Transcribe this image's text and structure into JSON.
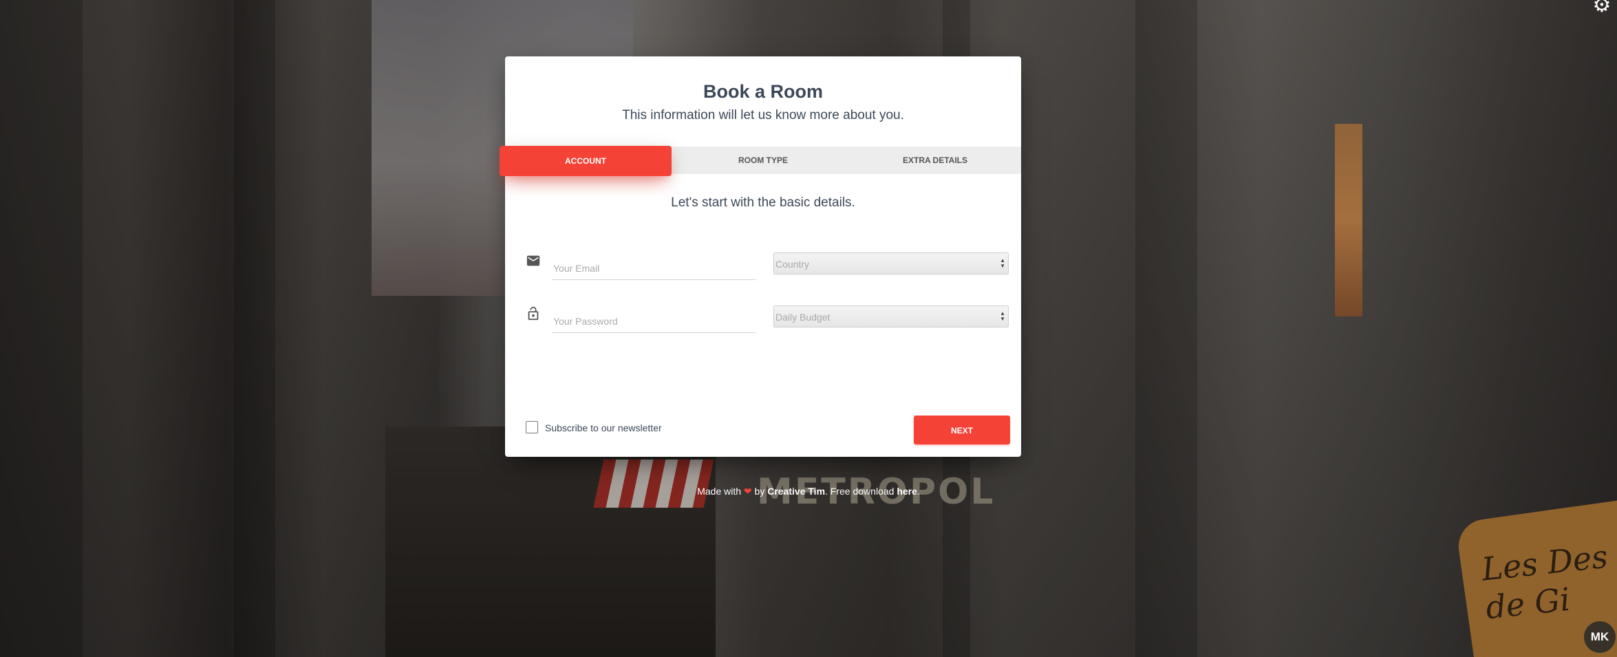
{
  "wizard": {
    "title": "Book a Room",
    "subtitle": "This information will let us know more about you.",
    "tabs": [
      {
        "label": "ACCOUNT",
        "active": true
      },
      {
        "label": "ROOM TYPE",
        "active": false
      },
      {
        "label": "EXTRA DETAILS",
        "active": false
      }
    ],
    "lead": "Let's start with the basic details.",
    "email": {
      "placeholder": "Your Email",
      "icon": "envelope-icon"
    },
    "password": {
      "placeholder": "Your Password",
      "icon": "lock-icon"
    },
    "country": {
      "value": "Country"
    },
    "budget": {
      "value": "Daily Budget"
    },
    "newsletter_label": "Subscribe to our newsletter",
    "next_label": "NEXT",
    "accent_color": "#f44336"
  },
  "footer": {
    "made_with": "Made with",
    "by": "by",
    "brand": "Creative Tim",
    "free_download": ". Free download",
    "here": "here",
    "end": "."
  },
  "settings_icon": "gear-icon",
  "avatar_initials": "MK"
}
